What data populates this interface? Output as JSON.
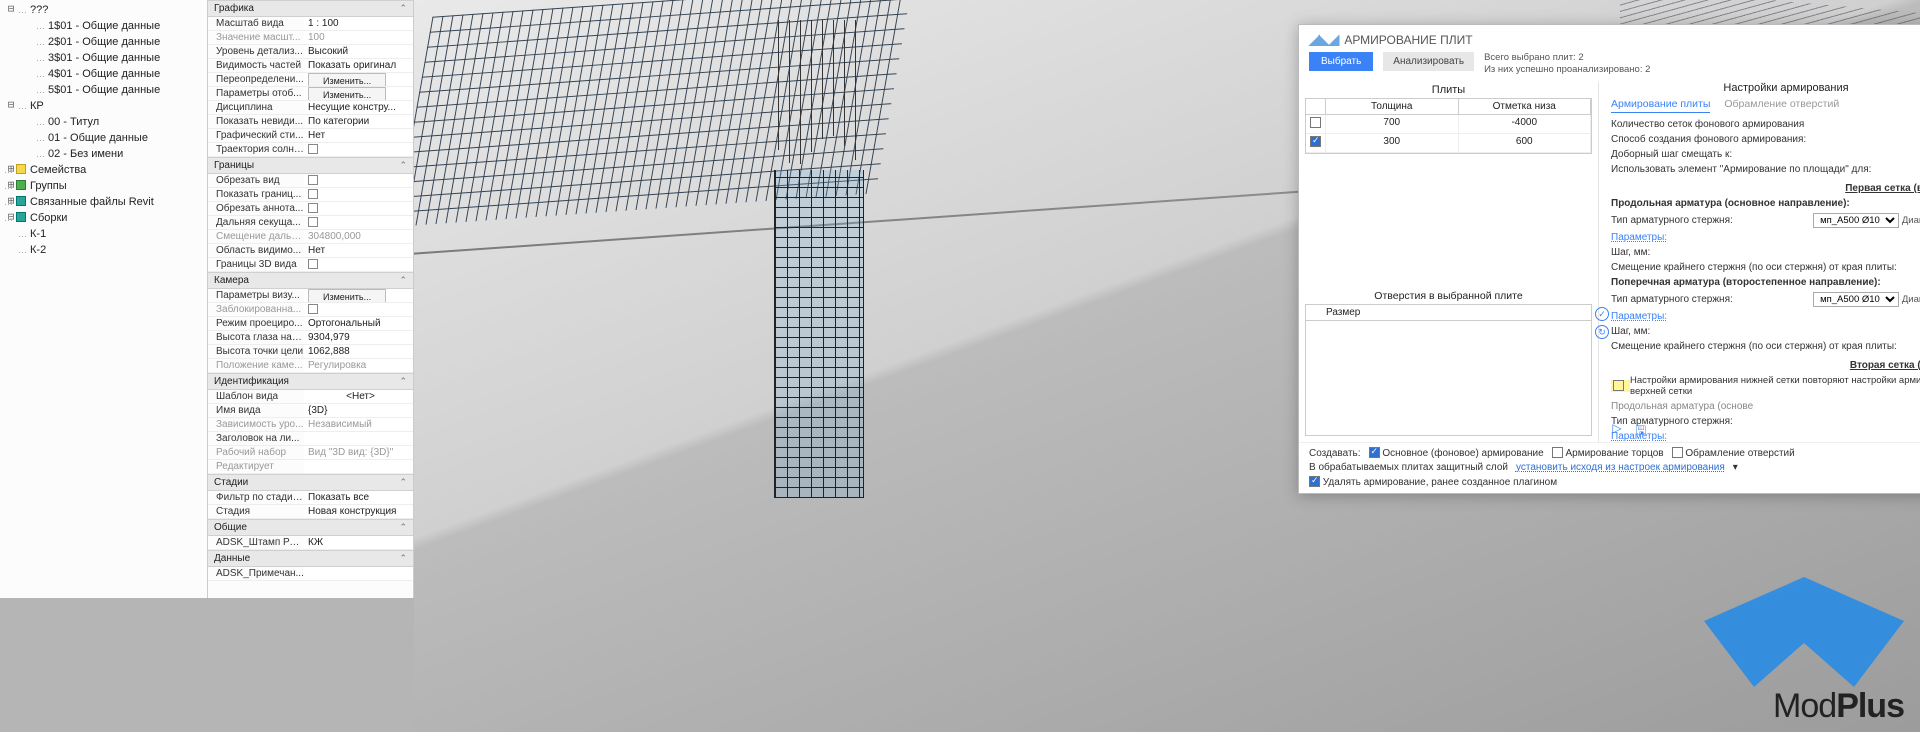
{
  "tree": {
    "unknown": "???",
    "views": [
      "1$01 - Общие данные",
      "2$01 - Общие данные",
      "3$01 - Общие данные",
      "4$01 - Общие данные",
      "5$01 - Общие данные"
    ],
    "kp_label": "КР",
    "kp": [
      "00 - Титул",
      "01 - Общие данные",
      "02 - Без имени"
    ],
    "families": "Семейства",
    "groups": "Группы",
    "links": "Связанные файлы Revit",
    "assemblies": "Сборки",
    "asm": [
      "К-1",
      "К-2"
    ]
  },
  "props": {
    "graphics": {
      "title": "Графика",
      "scale_k": "Масштаб вида",
      "scale_v": "1 : 100",
      "scaleval_k": "Значение масшт...",
      "scaleval_v": "100",
      "detail_k": "Уровень детализ...",
      "detail_v": "Высокий",
      "parts_k": "Видимость частей",
      "parts_v": "Показать оригинал",
      "override_k": "Переопределени...",
      "override_v": "Изменить...",
      "disp_k": "Параметры отоб...",
      "disp_v": "Изменить...",
      "disc_k": "Дисциплина",
      "disc_v": "Несущие констру...",
      "hidden_k": "Показать невиди...",
      "hidden_v": "По категории",
      "gstyle_k": "Графический сти...",
      "gstyle_v": "Нет",
      "sun_k": "Траектория солнца"
    },
    "bounds": {
      "title": "Границы",
      "crop_k": "Обрезать вид",
      "showcrop_k": "Показать границ...",
      "anncrop_k": "Обрезать аннота...",
      "farclip_k": "Дальняя секуща...",
      "faroff_k": "Смещение дальн...",
      "faroff_v": "304800,000",
      "scope_k": "Область видимо...",
      "scope_v": "Нет",
      "b3d_k": "Границы 3D вида"
    },
    "camera": {
      "title": "Камера",
      "rendset_k": "Параметры визу...",
      "rendset_v": "Изменить...",
      "locked_k": "Заблокированна...",
      "proj_k": "Режим проециро...",
      "proj_v": "Ортогональный",
      "eye_k": "Высота глаза наб...",
      "eye_v": "9304,979",
      "tgt_k": "Высота точки цели",
      "tgt_v": "1062,888",
      "campos_k": "Положение каме...",
      "campos_v": "Регулировка"
    },
    "ident": {
      "title": "Идентификация",
      "tmpl_k": "Шаблон вида",
      "tmpl_v": "<Нет>",
      "name_k": "Имя вида",
      "name_v": "{3D}",
      "dep_k": "Зависимость уро...",
      "dep_v": "Независимый",
      "titlesheet_k": "Заголовок на ли...",
      "ws_k": "Рабочий набор",
      "ws_v": "Вид \"3D вид: {3D}\"",
      "edit_k": "Редактирует"
    },
    "phasing": {
      "title": "Стадии",
      "filter_k": "Фильтр по стадиям",
      "filter_v": "Показать все",
      "phase_k": "Стадия",
      "phase_v": "Новая конструкция"
    },
    "shared": {
      "title": "Общие",
      "stamp_k": "ADSK_Штамп Раз...",
      "stamp_v": "КЖ"
    },
    "data": {
      "title": "Данные",
      "note_k": "ADSK_Примечан..."
    }
  },
  "dialog": {
    "title": "АРМИРОВАНИЕ ПЛИТ",
    "select": "Выбрать",
    "analyze": "Анализировать",
    "stat1": "Всего выбрано плит: 2",
    "stat2": "Из них успешно проанализировано: 2",
    "plates_title": "Плиты",
    "col_thick": "Толщина",
    "col_bottom": "Отметка низа",
    "rows": [
      {
        "on": false,
        "t": "700",
        "b": "-4000"
      },
      {
        "on": true,
        "t": "300",
        "b": "600"
      }
    ],
    "holes_title": "Отверстия в выбранной плите",
    "holes_col": "Размер",
    "settings_title": "Настройки армирования",
    "tab_a": "Армирование плиты",
    "tab_b": "Обрамление отверстий",
    "bg_count": "Количество сеток фонового армирования",
    "bg_method": "Способ создания фонового армирования:",
    "shift_to": "Доборный шаг смещать к:",
    "use_area": "Использовать элемент \"Армирование по площади\" для:",
    "sec_top": "Первая сетка (верхняя)",
    "long_main": "Продольная арматура (основное направление):",
    "bar_type": "Тип арматурного стержня:",
    "bar_type_v": "мп_А500 Ø10",
    "diam": "Диаметр, мм:",
    "params": "Параметры:",
    "step": "Шаг, мм:",
    "edge_off": "Смещение крайнего стержня (по оси стержня) от края плиты:",
    "trans_sec": "Поперечная арматура (второстепенное направление):",
    "sec_bot": "Вторая сетка (нижняя)",
    "repeat_cb": "Настройки армирования нижней сетки повторяют настройки армирования верхней сетки",
    "long_main2": "Продольная арматура (основе",
    "create_lbl": "Создавать:",
    "opt_main": "Основное (фоновое) армирование",
    "opt_ends": "Армирование торцов",
    "opt_holes": "Обрамление отверстий",
    "cover_lbl": "В обрабатываемых плитах защитный слой",
    "cover_v": "установить исходя из настроек армирования",
    "del_old": "Удалять армирование, ранее созданное плагином"
  },
  "brand": "ModPlus"
}
